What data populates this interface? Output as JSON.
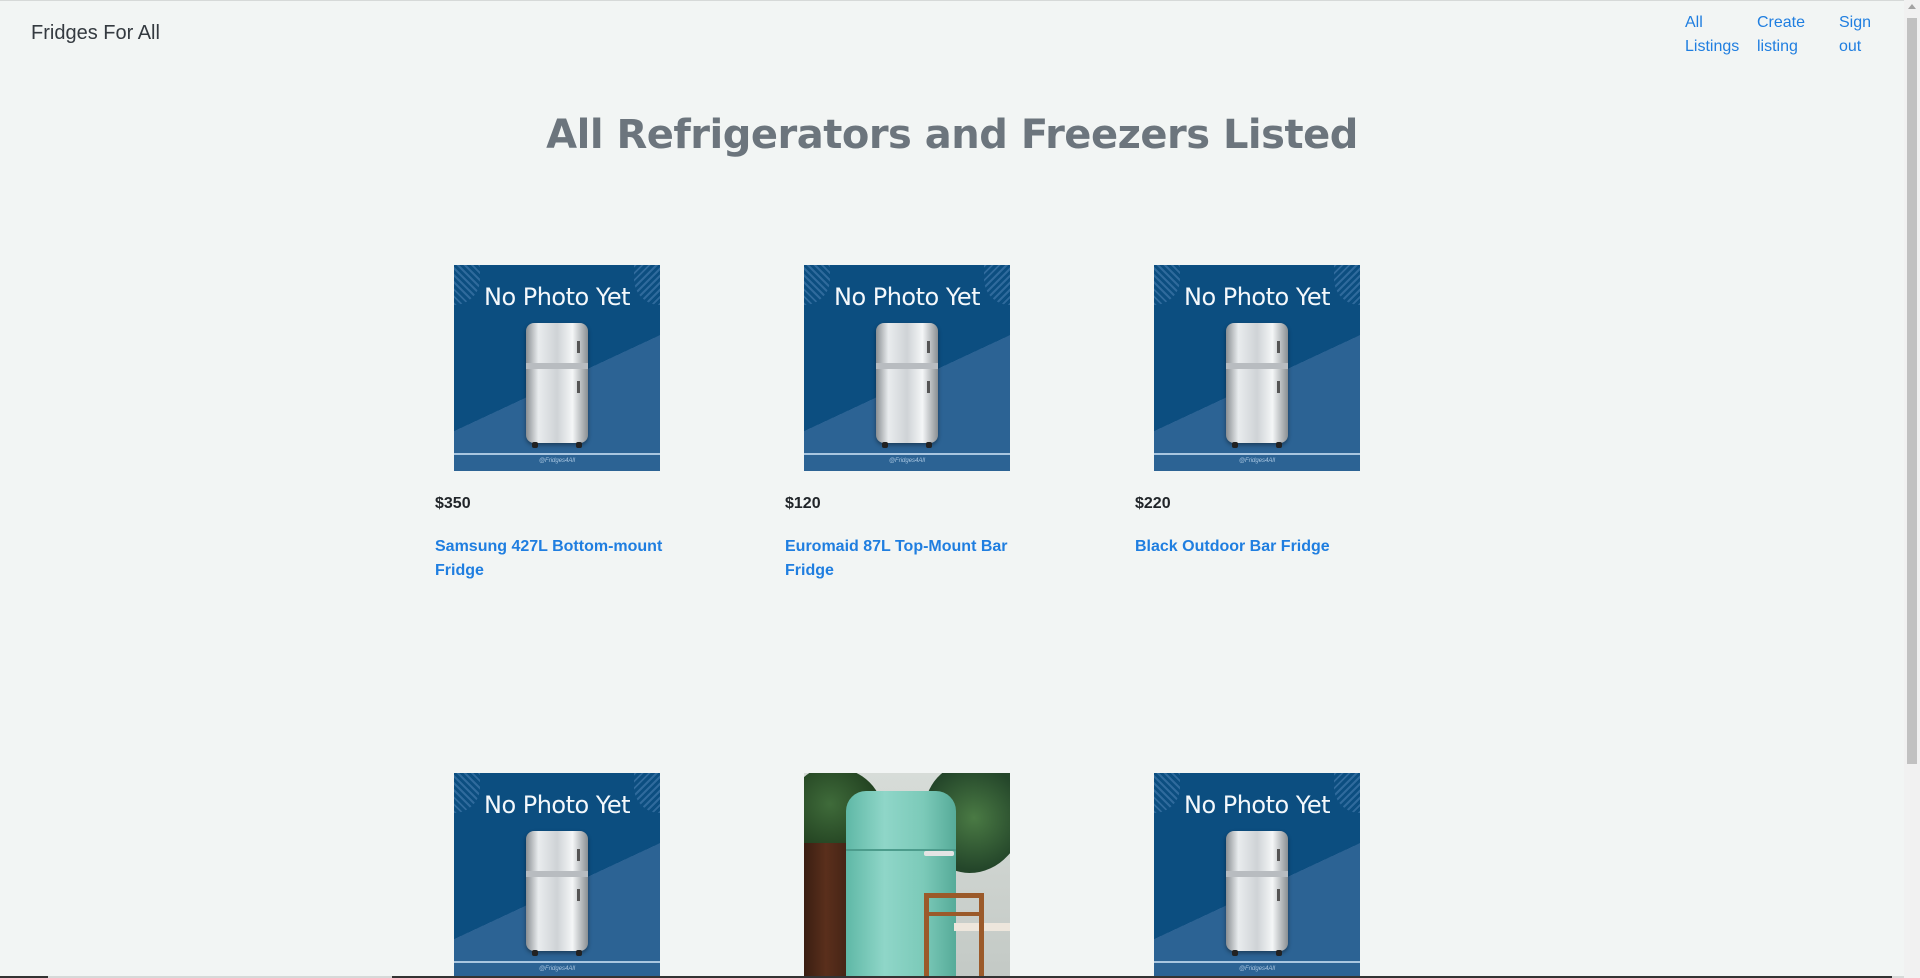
{
  "nav": {
    "brand": "Fridges For All",
    "links": [
      {
        "label": "All Listings"
      },
      {
        "label": "Create listing"
      },
      {
        "label": "Sign out"
      }
    ]
  },
  "page": {
    "title": "All Refrigerators and Freezers Listed"
  },
  "placeholder_image": {
    "text": "No Photo Yet",
    "credit": "@Fridges4All"
  },
  "listings": [
    {
      "price": "$350",
      "title": "Samsung 427L Bottom-mount Fridge",
      "image": "no-photo"
    },
    {
      "price": "$120",
      "title": "Euromaid 87L Top-Mount Bar Fridge",
      "image": "no-photo"
    },
    {
      "price": "$220",
      "title": "Black Outdoor Bar Fridge",
      "image": "no-photo"
    },
    {
      "price": "",
      "title": "",
      "image": "no-photo"
    },
    {
      "price": "",
      "title": "",
      "image": "photo-retro-mint-fridge"
    },
    {
      "price": "",
      "title": "",
      "image": "no-photo"
    }
  ],
  "colors": {
    "background": "#f2f5f4",
    "link": "#1f7ee0",
    "heading": "#6c757d",
    "placeholder_blue": "#0c4e80"
  }
}
